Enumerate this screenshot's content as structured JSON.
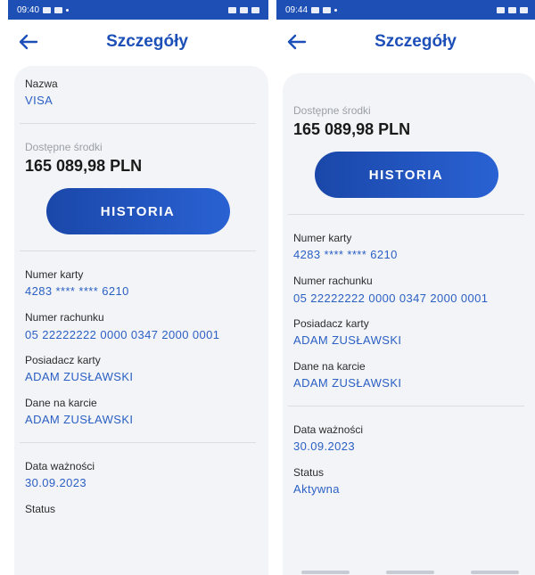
{
  "left": {
    "status": {
      "time": "09:40"
    },
    "header": {
      "title": "Szczegóły"
    },
    "fields": {
      "name_label": "Nazwa",
      "name_value": "VISA",
      "available_label": "Dostępne środki",
      "available_value": "165 089,98 PLN",
      "history_button": "HISTORIA",
      "card_number_label": "Numer karty",
      "card_number_value": "4283 **** **** 6210",
      "account_number_label": "Numer rachunku",
      "account_number_value": "05 22222222 0000 0347 2000 0001",
      "holder_label": "Posiadacz karty",
      "holder_value": "ADAM ZUSŁAWSKI",
      "on_card_label": "Dane na karcie",
      "on_card_value": "ADAM ZUSŁAWSKI",
      "expiry_label": "Data ważności",
      "expiry_value": "30.09.2023",
      "status_label": "Status"
    }
  },
  "right": {
    "status": {
      "time": "09:44"
    },
    "header": {
      "title": "Szczegóły"
    },
    "fields": {
      "available_label": "Dostępne środki",
      "available_value": "165 089,98 PLN",
      "history_button": "HISTORIA",
      "card_number_label": "Numer karty",
      "card_number_value": "4283 **** **** 6210",
      "account_number_label": "Numer rachunku",
      "account_number_value": "05 22222222 0000 0347 2000 0001",
      "holder_label": "Posiadacz karty",
      "holder_value": "ADAM ZUSŁAWSKI",
      "on_card_label": "Dane na karcie",
      "on_card_value": "ADAM ZUSŁAWSKI",
      "expiry_label": "Data ważności",
      "expiry_value": "30.09.2023",
      "status_label": "Status",
      "status_value": "Aktywna"
    }
  },
  "colors": {
    "accent": "#2a5fc4",
    "title": "#1d4fb8",
    "status_bar": "#1e4fb4",
    "card_bg": "#f3f4f7"
  },
  "icons": {
    "back": "arrow-left-icon"
  }
}
